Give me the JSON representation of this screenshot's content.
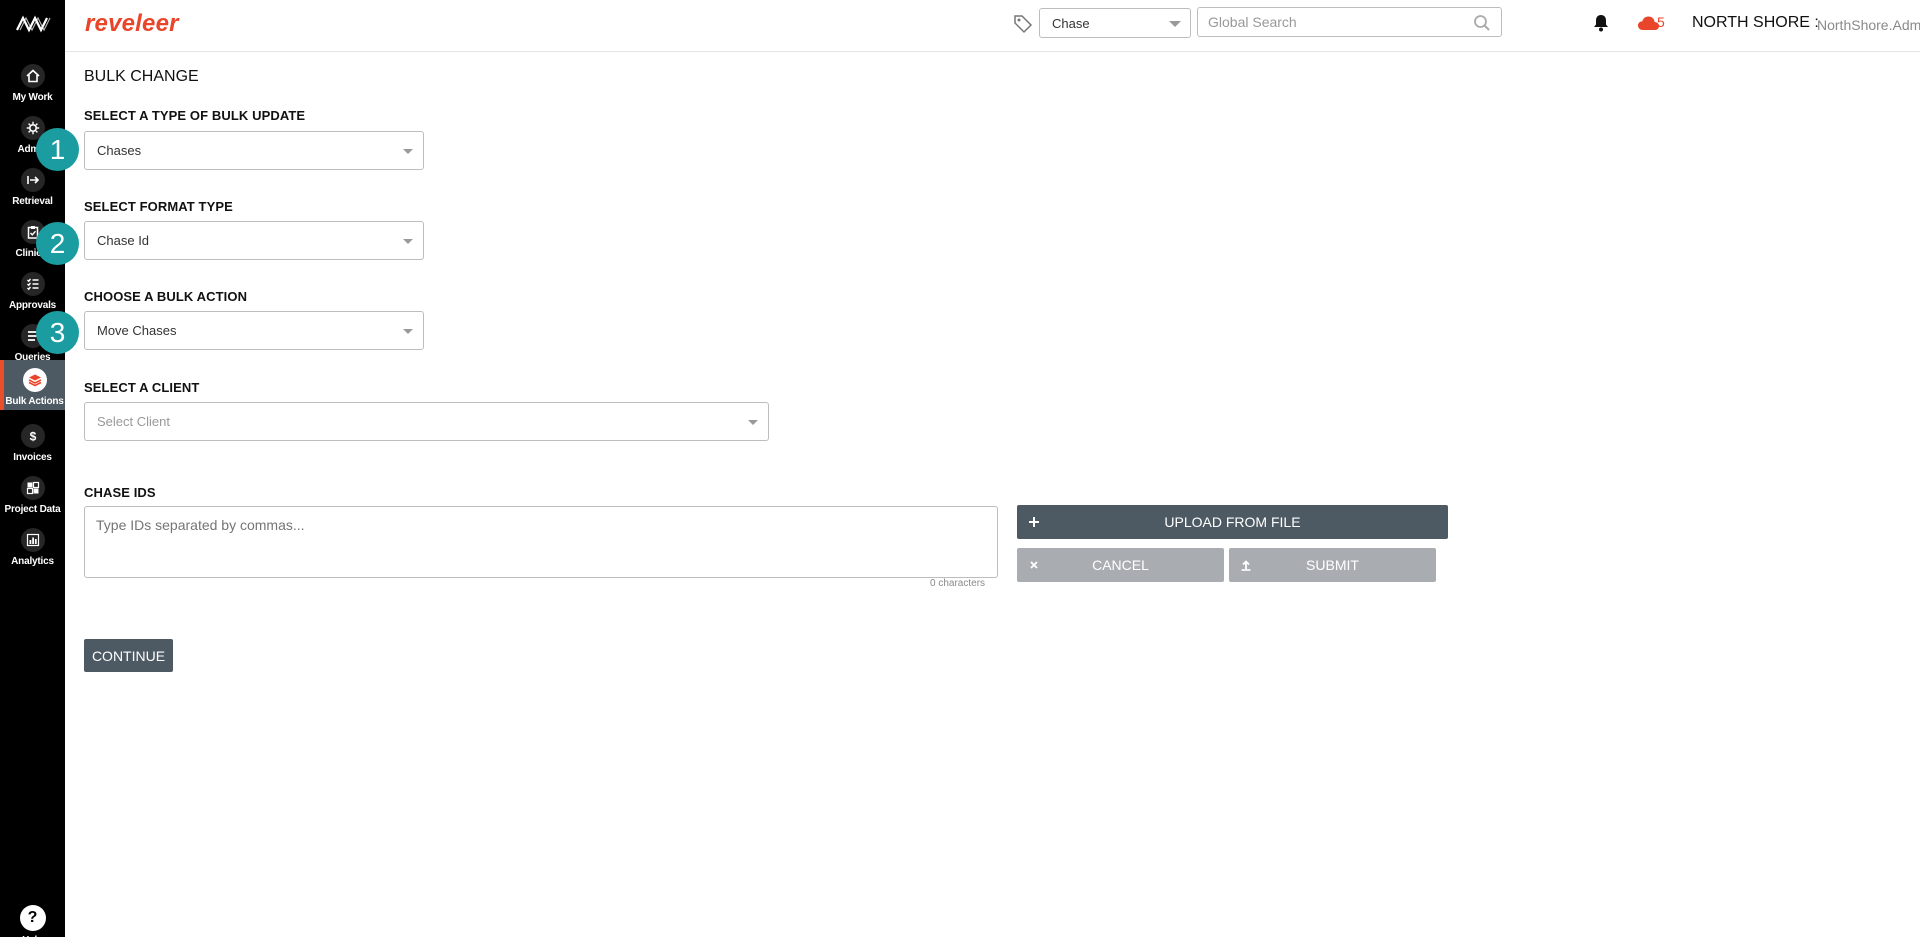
{
  "header": {
    "brand": "reveleer",
    "entity_select": "Chase",
    "search_placeholder": "Global Search",
    "cloud_count": "5",
    "org": "NORTH SHORE :",
    "user": "NorthShore.Admin"
  },
  "sidebar": {
    "items": [
      {
        "label": "My Work",
        "icon": "home-icon"
      },
      {
        "label": "Admin",
        "icon": "gear-icon"
      },
      {
        "label": "Retrieval",
        "icon": "arrow-right-icon"
      },
      {
        "label": "Clinical",
        "icon": "clipboard-icon"
      },
      {
        "label": "Approvals",
        "icon": "checklist-icon"
      },
      {
        "label": "Queries",
        "icon": "list-icon"
      },
      {
        "label": "Bulk Actions",
        "icon": "layers-icon"
      },
      {
        "label": "Invoices",
        "icon": "dollar-icon"
      },
      {
        "label": "Project Data",
        "icon": "grid-icon"
      },
      {
        "label": "Analytics",
        "icon": "bar-chart-icon"
      }
    ],
    "active": "Bulk Actions",
    "help_label": "Help"
  },
  "main": {
    "title": "BULK CHANGE",
    "type_label": "SELECT A TYPE OF BULK UPDATE",
    "type_value": "Chases",
    "format_label": "SELECT FORMAT TYPE",
    "format_value": "Chase Id",
    "action_label": "CHOOSE A BULK ACTION",
    "action_value": "Move Chases",
    "client_label": "SELECT A CLIENT",
    "client_placeholder": "Select Client",
    "ids_label": "CHASE IDS",
    "ids_placeholder": "Type IDs separated by commas...",
    "char_count": "0 characters",
    "upload_label": "UPLOAD FROM FILE",
    "cancel_label": "CANCEL",
    "submit_label": "SUBMIT",
    "continue_label": "CONTINUE"
  },
  "steps": [
    "1",
    "2",
    "3"
  ],
  "colors": {
    "brand": "#e8452a",
    "sidebar_bg": "#000000",
    "button_dark": "#4e5a63",
    "button_disabled": "#a9adb1",
    "step_badge": "#1a9ca0"
  }
}
